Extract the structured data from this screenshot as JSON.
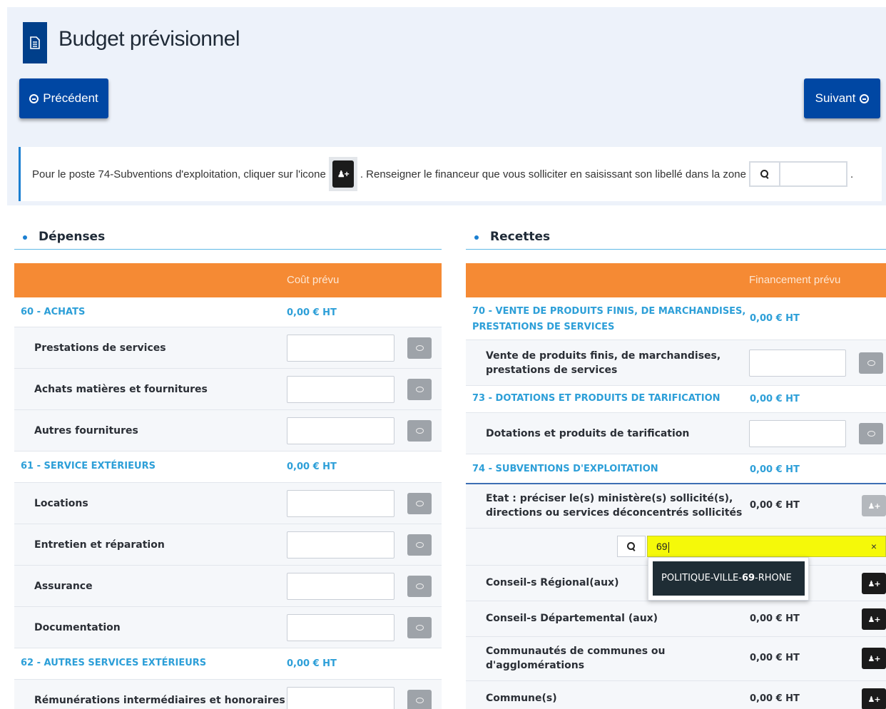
{
  "header": {
    "title": "Budget prévisionnel",
    "title_icon": "document-icon",
    "prev_label": "Précédent",
    "next_label": "Suivant"
  },
  "info": {
    "text_before_icon": "Pour le poste 74-Subventions d'exploitation, cliquer sur l'icone",
    "text_after_icon": ". Renseigner le financeur que vous solliciter en saisissant son libellé dans la zone",
    "text_end": "."
  },
  "depenses": {
    "title": "Dépenses",
    "column_header": "Coût prévu",
    "rows": [
      {
        "type": "cat",
        "label": "60 - ACHATS",
        "value": "0,00 € HT"
      },
      {
        "type": "item",
        "label": "Prestations de services"
      },
      {
        "type": "item",
        "label": "Achats matières et fournitures"
      },
      {
        "type": "item",
        "label": "Autres fournitures"
      },
      {
        "type": "cat",
        "label": "61 - SERVICE EXTÉRIEURS",
        "value": "0,00 € HT"
      },
      {
        "type": "item",
        "label": "Locations"
      },
      {
        "type": "item",
        "label": "Entretien et réparation"
      },
      {
        "type": "item",
        "label": "Assurance"
      },
      {
        "type": "item",
        "label": "Documentation"
      },
      {
        "type": "cat",
        "label": "62 - AUTRES SERVICES EXTÉRIEURS",
        "value": "0,00 € HT"
      },
      {
        "type": "item",
        "label": "Rémunérations intermédiaires et honoraires"
      }
    ]
  },
  "recettes": {
    "title": "Recettes",
    "column_header": "Financement prévu",
    "cat70": {
      "label_line1": "70 - VENTE DE PRODUITS FINIS, DE MARCHANDISES,",
      "label_line2": "PRESTATIONS DE SERVICES",
      "value": "0,00 € HT"
    },
    "item70": {
      "label_line1": "Vente de produits finis, de marchandises,",
      "label_line2": "prestations de services"
    },
    "cat73": {
      "label": "73 - DOTATIONS ET PRODUITS DE TARIFICATION",
      "value": "0,00 € HT"
    },
    "item73": {
      "label": "Dotations et produits de tarification"
    },
    "cat74": {
      "label": "74 - SUBVENTIONS D'EXPLOITATION",
      "value": "0,00 € HT"
    },
    "etat": {
      "label_line1": "Etat : préciser le(s) ministère(s) sollicité(s),",
      "label_line2": "directions ou services déconcentrés sollicités",
      "value": "0,00 € HT"
    },
    "search": {
      "value": "69",
      "clear": "×"
    },
    "dropdown": {
      "before": "POLITIQUE-VILLE-",
      "match": "69",
      "after": "-RHONE"
    },
    "conseil_regional": {
      "label": "Conseil-s Régional(aux)"
    },
    "conseil_departemental": {
      "label": "Conseil-s Départemental (aux)",
      "value": "0,00 € HT"
    },
    "communautes": {
      "label_line1": "Communautés de communes ou",
      "label_line2": "d'agglomérations",
      "value": "0,00 € HT"
    },
    "communes": {
      "label": "Commune(s)",
      "value": "0,00 € HT"
    }
  }
}
